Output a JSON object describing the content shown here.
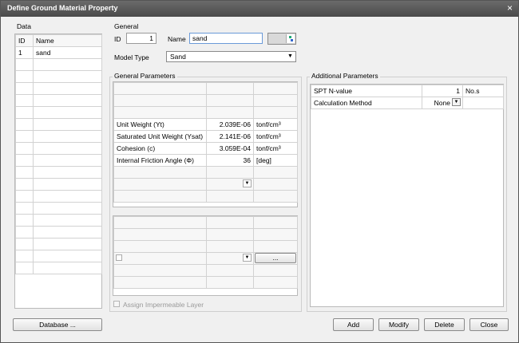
{
  "window": {
    "title": "Define Ground Material Property",
    "close_glyph": "×"
  },
  "data_panel": {
    "group_label": "Data",
    "columns": [
      "ID",
      "Name"
    ],
    "rows": [
      {
        "id": "1",
        "name": "sand"
      }
    ]
  },
  "general": {
    "group_label": "General",
    "id_label": "ID",
    "id_value": "1",
    "name_label": "Name",
    "name_value": "sand",
    "model_type_label": "Model Type",
    "model_type_value": "Sand"
  },
  "general_parameters": {
    "group_label": "General Parameters",
    "rows": [
      {
        "label": "Unit Weight (Yt)",
        "value": "2.039E-06",
        "unit": "tonf/cm³"
      },
      {
        "label": "Saturated Unit Weight (Ysat)",
        "value": "2.141E-06",
        "unit": "tonf/cm³"
      },
      {
        "label": "Cohesion (c)",
        "value": "3.059E-04",
        "unit": "tonf/cm³"
      },
      {
        "label": "Internal Friction Angle (Φ)",
        "value": "36",
        "unit": "[deg]"
      }
    ],
    "lower_button_label": "...",
    "assign_impermeable_label": "Assign Impermeable Layer"
  },
  "additional_parameters": {
    "group_label": "Additional Parameters",
    "rows": [
      {
        "label": "SPT N-value",
        "value": "1",
        "unit": "No.s"
      },
      {
        "label": "Calculation Method",
        "value": "None",
        "unit": ""
      }
    ]
  },
  "buttons": {
    "database": "Database ...",
    "add": "Add",
    "modify": "Modify",
    "delete": "Delete",
    "close": "Close"
  },
  "colors": {
    "title_bar": "#555555",
    "dialog_bg": "#f0f0f0"
  }
}
